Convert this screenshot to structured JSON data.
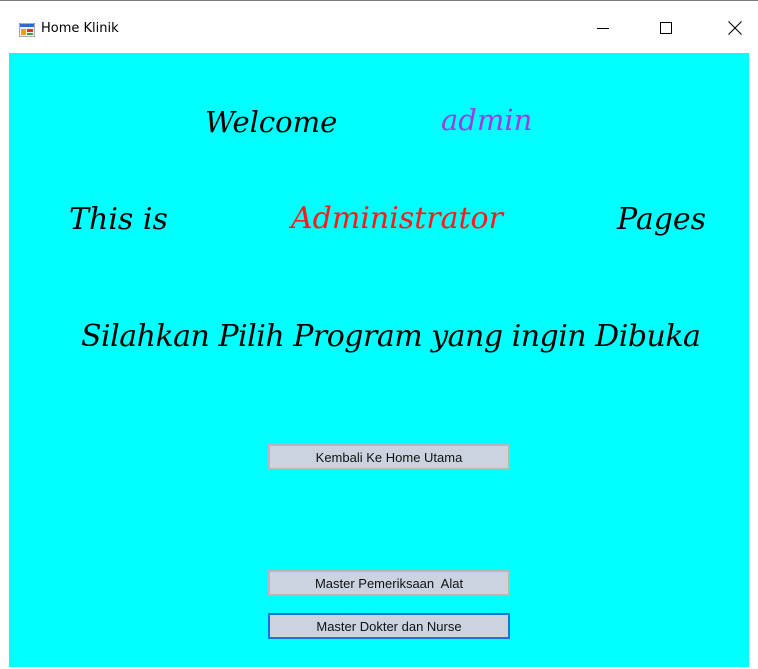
{
  "window": {
    "title": "Home Klinik",
    "app_icon": "windows-form-icon",
    "controls": {
      "minimize": "minimize-icon",
      "maximize": "maximize-icon",
      "close": "close-icon"
    }
  },
  "labels": {
    "welcome": "Welcome",
    "username": "admin",
    "this_is": "This is",
    "role": "Administrator",
    "pages": "Pages",
    "instruction": "Silahkan Pilih Program yang ingin Dibuka"
  },
  "buttons": {
    "home": "Kembali Ke Home Utama",
    "pemeriksaan": "Master Pemeriksaan  Alat",
    "dokter": "Master Dokter dan Nurse"
  },
  "colors": {
    "background": "#00ffff",
    "username": "#9b3fe0",
    "role": "#ff1a1a",
    "text": "#000000",
    "button_face": "#cbd3e0",
    "focus_border": "#1a74d8"
  }
}
